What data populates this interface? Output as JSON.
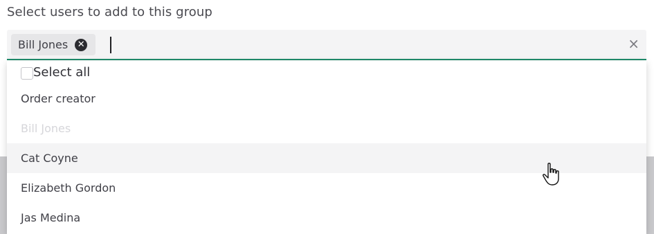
{
  "title": "Select users to add to this group",
  "selected_chips": [
    {
      "label": "Bill Jones",
      "remove_icon": "x-circle-icon"
    }
  ],
  "input": {
    "value": "",
    "clear_icon": "close-icon",
    "clear_glyph": "×"
  },
  "dropdown": {
    "select_all_label": "Select all",
    "select_all_checked": false,
    "options": [
      {
        "label": "Order creator",
        "state": "normal"
      },
      {
        "label": "Bill Jones",
        "state": "disabled"
      },
      {
        "label": "Cat Coyne",
        "state": "hover"
      },
      {
        "label": "Elizabeth Gordon",
        "state": "normal"
      },
      {
        "label": "Jas Medina",
        "state": "normal"
      }
    ]
  },
  "colors": {
    "accent": "#1f8c6c",
    "field_background": "#f4f4f5",
    "disabled_text": "#d6d6da"
  }
}
